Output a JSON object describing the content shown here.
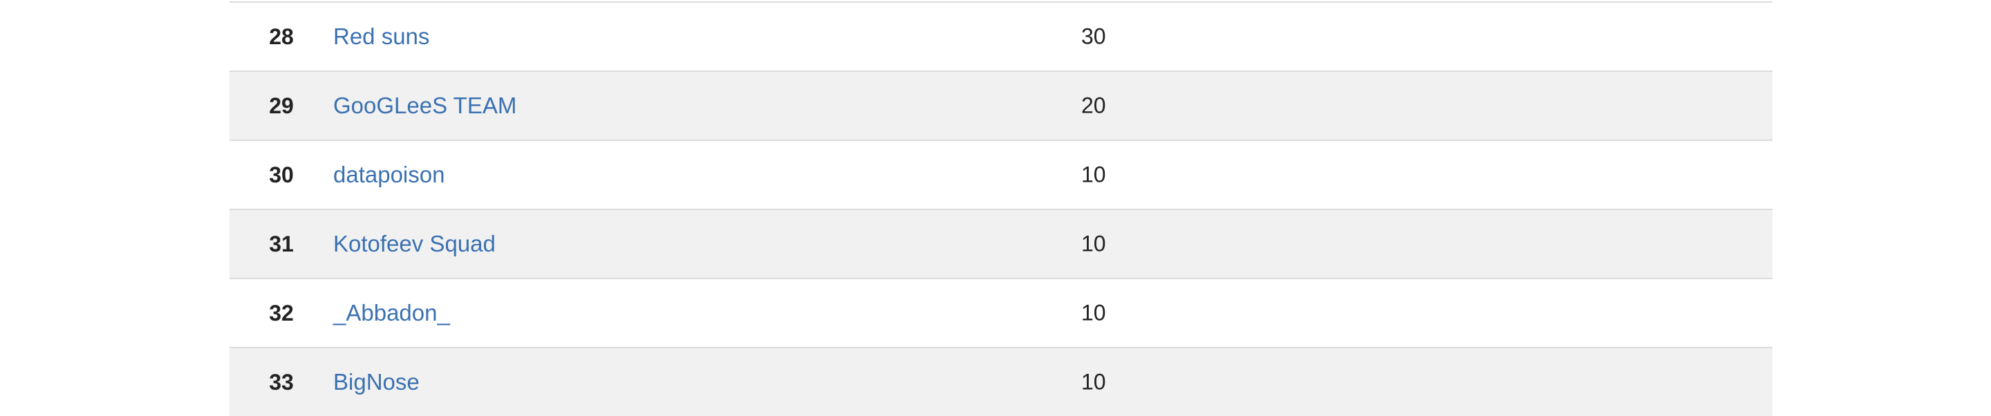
{
  "scoreboard": {
    "rows": [
      {
        "rank": "28",
        "team": "Red suns",
        "points": "30"
      },
      {
        "rank": "29",
        "team": "GooGLeeS TEAM",
        "points": "20"
      },
      {
        "rank": "30",
        "team": "datapoison",
        "points": "10"
      },
      {
        "rank": "31",
        "team": "Kotofeev Squad",
        "points": "10"
      },
      {
        "rank": "32",
        "team": "_Abbadon_",
        "points": "10"
      },
      {
        "rank": "33",
        "team": "BigNose",
        "points": "10"
      }
    ]
  },
  "colors": {
    "link": "#3b71b1",
    "row_alt": "#f1f1f1",
    "divider": "#dcdcdc",
    "text": "#222222"
  }
}
